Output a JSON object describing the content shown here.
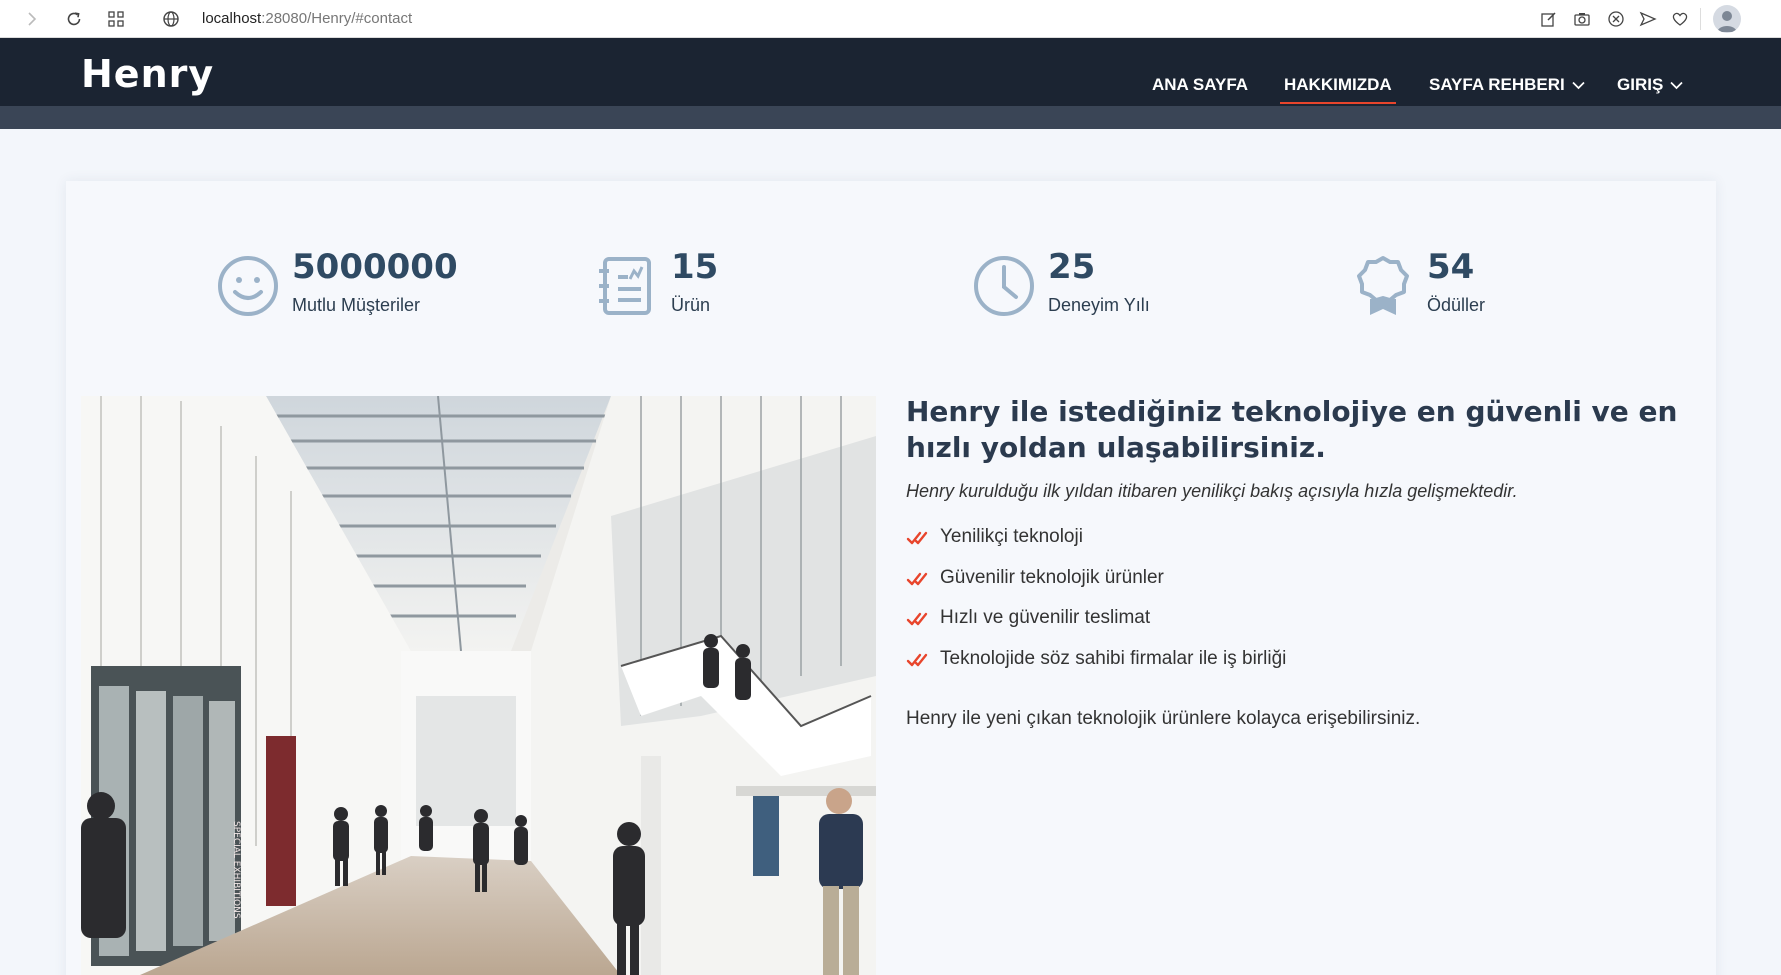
{
  "browser": {
    "url_host": "localhost",
    "url_rest": ":28080/Henry/#contact"
  },
  "site": {
    "logo": "Henry",
    "nav": [
      {
        "label": "ANA SAYFA",
        "has_dropdown": false,
        "active": false
      },
      {
        "label": "HAKKIMIZDA",
        "has_dropdown": false,
        "active": true
      },
      {
        "label": "SAYFA REHBERI",
        "has_dropdown": true,
        "active": false
      },
      {
        "label": "GIRIŞ",
        "has_dropdown": true,
        "active": false
      }
    ],
    "accent_color": "#e8452c"
  },
  "stats": [
    {
      "icon": "smile-icon",
      "value": "5000000",
      "label": "Mutlu Müşteriler"
    },
    {
      "icon": "journal-icon",
      "value": "15",
      "label": "Ürün"
    },
    {
      "icon": "clock-icon",
      "value": "25",
      "label": "Deneyim Yılı"
    },
    {
      "icon": "award-icon",
      "value": "54",
      "label": "Ödüller"
    }
  ],
  "about": {
    "title": "Henry ile istediğiniz teknolojiye en güvenli ve en hızlı yoldan ulaşabilirsiniz.",
    "subtitle": "Henry kurulduğu ilk yıldan itibaren yenilikçi bakış açısıyla hızla gelişmektedir.",
    "features": [
      "Yenilikçi teknoloji",
      "Güvenilir teknolojik ürünler",
      "Hızlı ve güvenilir teslimat",
      "Teknolojide söz sahibi firmalar ile iş birliği"
    ],
    "note": "Henry ile yeni çıkan teknolojik ürünlere kolayca erişebilirsiniz."
  }
}
